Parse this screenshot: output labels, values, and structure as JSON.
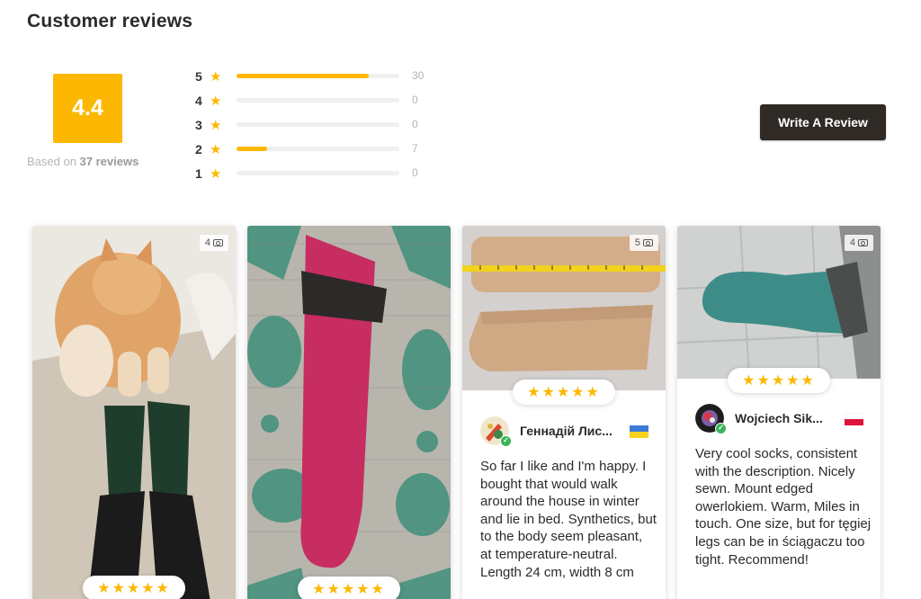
{
  "header": {
    "title": "Customer reviews"
  },
  "summary": {
    "score": "4.4",
    "based_prefix": "Based on ",
    "based_count": "37 reviews"
  },
  "breakdown": [
    {
      "stars": "5",
      "count": "30",
      "fraction": 0.81
    },
    {
      "stars": "4",
      "count": "0",
      "fraction": 0
    },
    {
      "stars": "3",
      "count": "0",
      "fraction": 0
    },
    {
      "stars": "2",
      "count": "7",
      "fraction": 0.19
    },
    {
      "stars": "1",
      "count": "0",
      "fraction": 0
    }
  ],
  "write_button": "Write A Review",
  "star_glyph": "★",
  "star_rating": "★★★★★",
  "colors": {
    "accent": "#fcb800",
    "button": "#2f2a25",
    "verified": "#3bb45a"
  },
  "cards": [
    {
      "photo_count": "4",
      "photo": "cat-and-green-socks",
      "rating": 5
    },
    {
      "photo_count": "",
      "photo": "pink-sock-on-rug",
      "rating": 5
    },
    {
      "photo_count": "5",
      "photo": "beige-socks-with-tape-measure",
      "rating": 5,
      "name": "Геннадій Лис...",
      "flag": "ukraine-flag",
      "text": "So far I like and I'm happy. I bought that would walk around the house in winter and lie in bed. Synthetics, but to the body seem pleasant, at temperature-neutral. Length 24 cm, width 8 cm"
    },
    {
      "photo_count": "4",
      "photo": "teal-sock-on-foot",
      "rating": 5,
      "name": "Wojciech Sik...",
      "flag": "poland-flag",
      "text": "Very cool socks, consistent with the description. Nicely sewn. Mount edged owerlokiem. Warm, Miles in touch. One size, but for tęgiej legs can be in ściągaczu too tight. Recommend!"
    }
  ]
}
